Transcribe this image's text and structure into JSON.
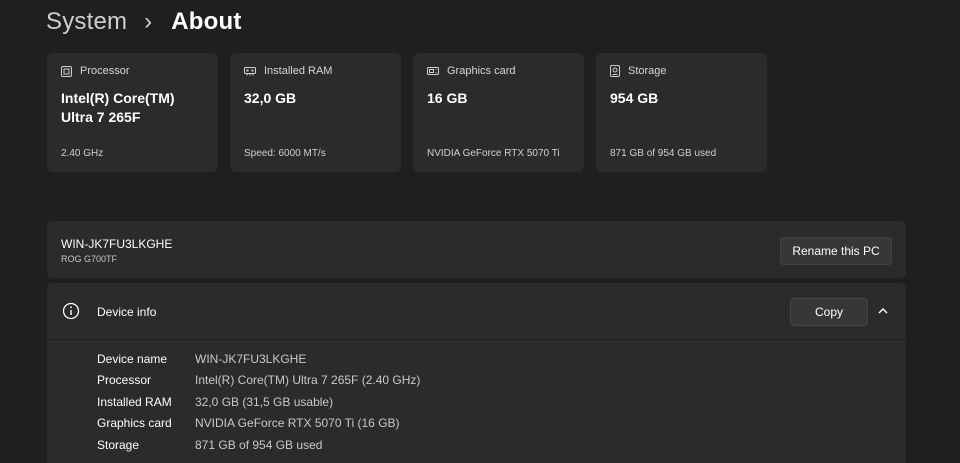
{
  "breadcrumb": {
    "parent": "System",
    "separator": "›",
    "current": "About"
  },
  "cards": [
    {
      "icon": "processor-icon",
      "title": "Processor",
      "value": "Intel(R) Core(TM) Ultra 7 265F",
      "sub": "2.40 GHz"
    },
    {
      "icon": "ram-icon",
      "title": "Installed RAM",
      "value": "32,0 GB",
      "sub": "Speed: 6000 MT/s"
    },
    {
      "icon": "graphics-card-icon",
      "title": "Graphics card",
      "value": "16 GB",
      "sub": "NVIDIA GeForce RTX 5070 Ti"
    },
    {
      "icon": "storage-icon",
      "title": "Storage",
      "value": "954 GB",
      "sub": "871 GB of 954 GB used"
    }
  ],
  "pc": {
    "name": "WIN-JK7FU3LKGHE",
    "model": "ROG G700TF",
    "rename_label": "Rename this PC"
  },
  "device_info": {
    "icon": "info-icon",
    "title": "Device info",
    "copy_label": "Copy",
    "rows": [
      {
        "label": "Device name",
        "value": "WIN-JK7FU3LKGHE"
      },
      {
        "label": "Processor",
        "value": "Intel(R) Core(TM) Ultra 7 265F (2.40 GHz)"
      },
      {
        "label": "Installed RAM",
        "value": "32,0 GB (31,5 GB usable)"
      },
      {
        "label": "Graphics card",
        "value": "NVIDIA GeForce RTX 5070 Ti (16 GB)"
      },
      {
        "label": "Storage",
        "value": "871 GB of 954 GB used"
      }
    ]
  },
  "colors": {
    "background": "#1f1f1f",
    "card": "#2b2b2b",
    "button": "#373737"
  }
}
